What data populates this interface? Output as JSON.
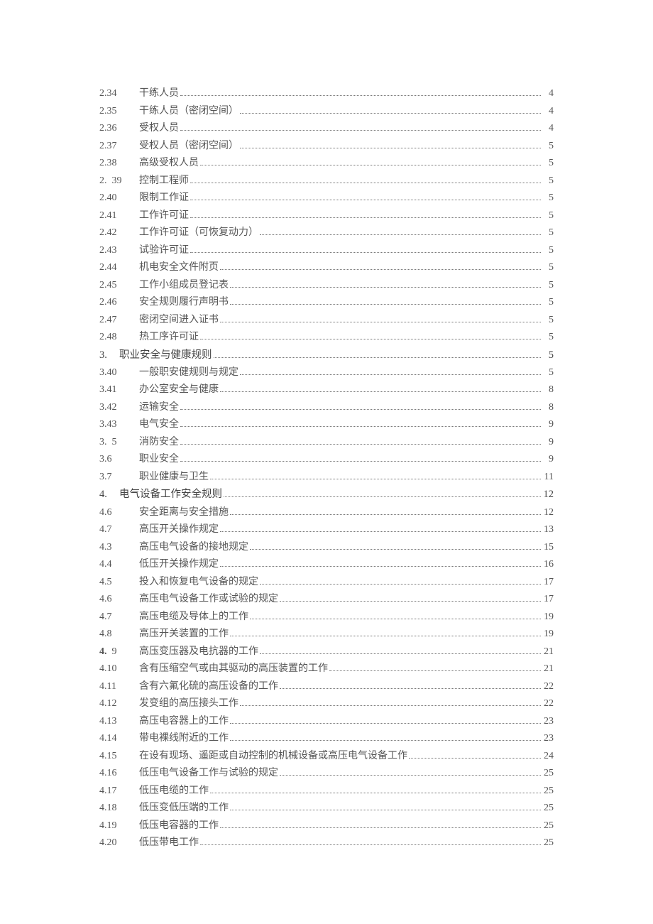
{
  "toc": [
    {
      "num": "2.34",
      "title": "干练人员",
      "page": "4",
      "section": false
    },
    {
      "num": "2.35",
      "title": "干练人员（密闭空间）",
      "page": "4",
      "section": false
    },
    {
      "num": "2.36",
      "title": "受权人员",
      "page": "4",
      "section": false
    },
    {
      "num": "2.37",
      "title": "受权人员（密闭空间）",
      "page": "5",
      "section": false
    },
    {
      "num": "2.38",
      "title": "高级受权人员",
      "page": "5",
      "section": false
    },
    {
      "num": "2.  39",
      "title": "控制工程师",
      "page": "5",
      "section": false
    },
    {
      "num": "2.40",
      "title": "限制工作证",
      "page": "5",
      "section": false
    },
    {
      "num": "2.41",
      "title": "工作许可证",
      "page": "5",
      "section": false
    },
    {
      "num": "2.42",
      "title": "工作许可证（可恢复动力）",
      "page": "5",
      "section": false
    },
    {
      "num": "2.43",
      "title": "试验许可证",
      "page": "5",
      "section": false
    },
    {
      "num": "2.44",
      "title": "机电安全文件附页",
      "page": "5",
      "section": false
    },
    {
      "num": "2.45",
      "title": "工作小组成员登记表",
      "page": "5",
      "section": false
    },
    {
      "num": "2.46",
      "title": "安全规则履行声明书",
      "page": "5",
      "section": false
    },
    {
      "num": "2.47",
      "title": "密闭空间进入证书",
      "page": "5",
      "section": false
    },
    {
      "num": "2.48",
      "title": "热工序许可证",
      "page": "5",
      "section": false
    },
    {
      "num": "3.",
      "title": "职业安全与健康规则",
      "page": "5",
      "section": true
    },
    {
      "num": "3.40",
      "title": "一般职安健规则与规定",
      "page": "5",
      "section": false
    },
    {
      "num": "3.41",
      "title": "办公室安全与健康",
      "page": "8",
      "section": false
    },
    {
      "num": "3.42",
      "title": "运输安全",
      "page": "8",
      "section": false
    },
    {
      "num": "3.43",
      "title": "电气安全",
      "page": "9",
      "section": false
    },
    {
      "num": "3.  5",
      "title": "消防安全",
      "page": "9",
      "section": false
    },
    {
      "num": "3.6",
      "title": "职业安全",
      "page": "9",
      "section": false
    },
    {
      "num": "3.7",
      "title": "职业健康与卫生",
      "page": "11",
      "section": false
    },
    {
      "num": "4.",
      "title": "电气设备工作安全规则",
      "page": "12",
      "section": true
    },
    {
      "num": "4.6",
      "title": "安全距离与安全措施",
      "page": "12",
      "section": false
    },
    {
      "num": "4.7",
      "title": "高压开关操作规定",
      "page": "13",
      "section": false
    },
    {
      "num": "4.3",
      "title": "高压电气设备的接地规定",
      "page": "15",
      "section": false
    },
    {
      "num": "4.4",
      "title": "低压开关操作规定",
      "page": "16",
      "section": false
    },
    {
      "num": "4.5",
      "title": "投入和恢复电气设备的规定",
      "page": "17",
      "section": false
    },
    {
      "num": "4.6",
      "title": "高压电气设备工作或试验的规定",
      "page": "17",
      "section": false
    },
    {
      "num": "4.7",
      "title": "高压电缆及导体上的工作",
      "page": "19",
      "section": false
    },
    {
      "num": "4.8",
      "title": "高压开关装置的工作",
      "page": "19",
      "section": false
    },
    {
      "num": "4.  9",
      "title": "高压变压器及电抗器的工作",
      "page": "21",
      "section": false,
      "boldnum": true
    },
    {
      "num": "4.10",
      "title": "含有压缩空气或由其驱动的高压装置的工作",
      "page": "21",
      "section": false
    },
    {
      "num": "4.11",
      "title": "含有六氟化硫的高压设备的工作",
      "page": "22",
      "section": false
    },
    {
      "num": "4.12",
      "title": "发变组的高压接头工作",
      "page": "22",
      "section": false
    },
    {
      "num": "4.13",
      "title": "高压电容器上的工作",
      "page": "23",
      "section": false
    },
    {
      "num": "4.14",
      "title": "带电裸线附近的工作",
      "page": "23",
      "section": false
    },
    {
      "num": "4.15",
      "title": "在设有现场、遥距或自动控制的机械设备或高压电气设备工作",
      "page": "24",
      "section": false
    },
    {
      "num": "4.16",
      "title": "低压电气设备工作与试验的规定",
      "page": "25",
      "section": false
    },
    {
      "num": "4.17",
      "title": "低压电缆的工作",
      "page": "25",
      "section": false
    },
    {
      "num": "4.18",
      "title": "低压变低压端的工作",
      "page": "25",
      "section": false
    },
    {
      "num": "4.19",
      "title": "低压电容器的工作",
      "page": "25",
      "section": false
    },
    {
      "num": "4.20",
      "title": "低压带电工作",
      "page": "25",
      "section": false
    }
  ]
}
